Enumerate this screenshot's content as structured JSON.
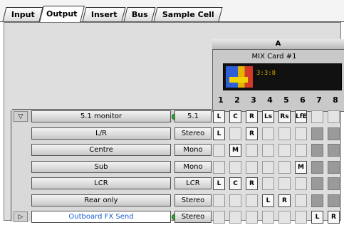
{
  "tabs": [
    {
      "label": "Input",
      "active": false
    },
    {
      "label": "Output",
      "active": true
    },
    {
      "label": "Insert",
      "active": false
    },
    {
      "label": "Bus",
      "active": false
    },
    {
      "label": "Sample Cell",
      "active": false
    }
  ],
  "card": {
    "letter": "A",
    "name": "MIX Card #1",
    "display_text": "3:3:8"
  },
  "columns": [
    "1",
    "2",
    "3",
    "4",
    "5",
    "6",
    "7",
    "8"
  ],
  "rows": [
    {
      "name": "5.1 monitor",
      "arrow": "▽",
      "led": true,
      "format": "5.1",
      "cells": [
        "L",
        "C",
        "R",
        "Ls",
        "Rs",
        "LfE",
        "",
        ""
      ],
      "style": "normal"
    },
    {
      "name": "L/R",
      "arrow": "",
      "led": false,
      "format": "Stereo",
      "cells": [
        "L",
        "",
        "R",
        "",
        "",
        "",
        "",
        ""
      ],
      "style": "normal"
    },
    {
      "name": "Centre",
      "arrow": "",
      "led": false,
      "format": "Mono",
      "cells": [
        "",
        "M",
        "",
        "",
        "",
        "",
        "",
        ""
      ],
      "style": "normal"
    },
    {
      "name": "Sub",
      "arrow": "",
      "led": false,
      "format": "Mono",
      "cells": [
        "",
        "",
        "",
        "",
        "",
        "M",
        "",
        ""
      ],
      "style": "normal"
    },
    {
      "name": "LCR",
      "arrow": "",
      "led": false,
      "format": "LCR",
      "cells": [
        "L",
        "C",
        "R",
        "",
        "",
        "",
        "",
        ""
      ],
      "style": "normal"
    },
    {
      "name": "Rear only",
      "arrow": "",
      "led": false,
      "format": "Stereo",
      "cells": [
        "",
        "",
        "",
        "L",
        "R",
        "",
        "",
        ""
      ],
      "style": "normal"
    },
    {
      "name": "Outboard FX Send",
      "arrow": "▷",
      "led": true,
      "format": "Stereo",
      "cells": [
        "",
        "",
        "",
        "",
        "",
        "",
        "L",
        "R"
      ],
      "style": "white"
    }
  ],
  "colors": {
    "led": "#22b522",
    "send_text": "#1c5fd0"
  }
}
